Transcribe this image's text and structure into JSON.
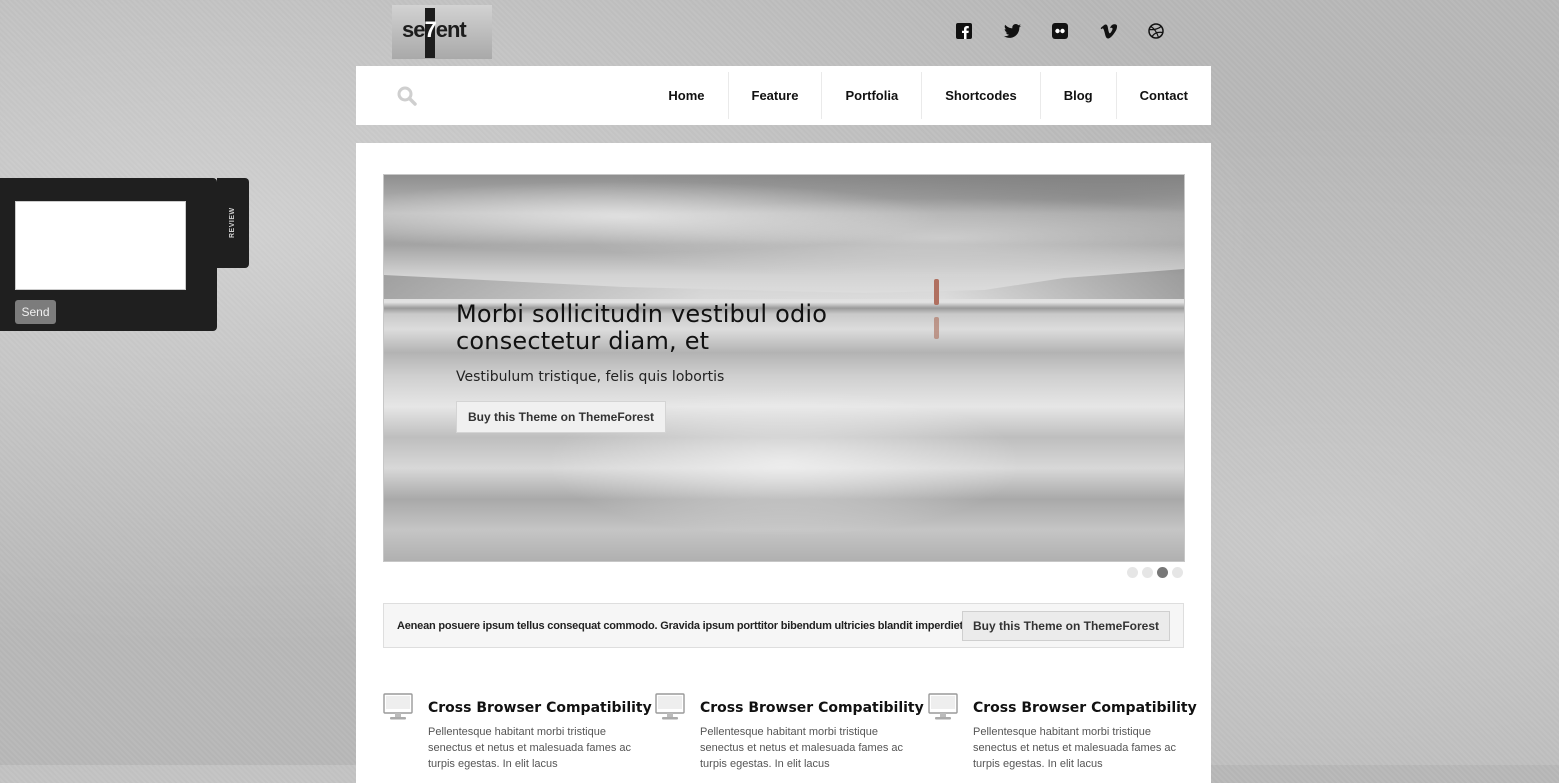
{
  "logo": {
    "text_pre": "se",
    "text_seven": "7",
    "text_post": "ent"
  },
  "social": [
    "facebook-icon",
    "twitter-icon",
    "flickr-icon",
    "vimeo-icon",
    "dribbble-icon"
  ],
  "nav": {
    "search_icon": "search-icon",
    "items": [
      {
        "label": "Home"
      },
      {
        "label": "Feature"
      },
      {
        "label": "Portfolia"
      },
      {
        "label": "Shortcodes"
      },
      {
        "label": "Blog"
      },
      {
        "label": "Contact"
      }
    ]
  },
  "slider": {
    "title": "Morbi sollicitudin vestibul odio consectetur diam, et",
    "subtitle": "Vestibulum tristique, felis quis lobortis",
    "button": "Buy this Theme on ThemeForest",
    "slide_count": 4,
    "active_slide": 3
  },
  "callout": {
    "text": "Aenean posuere ipsum tellus consequat commodo. Gravida ipsum porttitor bibendum ultricies blandit imperdiet",
    "button": "Buy this Theme on ThemeForest"
  },
  "features": [
    {
      "title": "Cross Browser Compatibility",
      "text": "Pellentesque habitant morbi tristique senectus et netus et malesuada fames ac turpis egestas. In elit lacus",
      "icon": "monitor-icon"
    },
    {
      "title": "Cross Browser Compatibility",
      "text": "Pellentesque habitant morbi tristique senectus et netus et malesuada fames ac turpis egestas. In elit lacus",
      "icon": "monitor-icon"
    },
    {
      "title": "Cross Browser Compatibility",
      "text": "Pellentesque habitant morbi tristique senectus et netus et malesuada fames ac turpis egestas. In elit lacus",
      "icon": "monitor-icon"
    }
  ],
  "review": {
    "tab_label": "REVIEW",
    "textarea_value": "",
    "send_label": "Send"
  }
}
